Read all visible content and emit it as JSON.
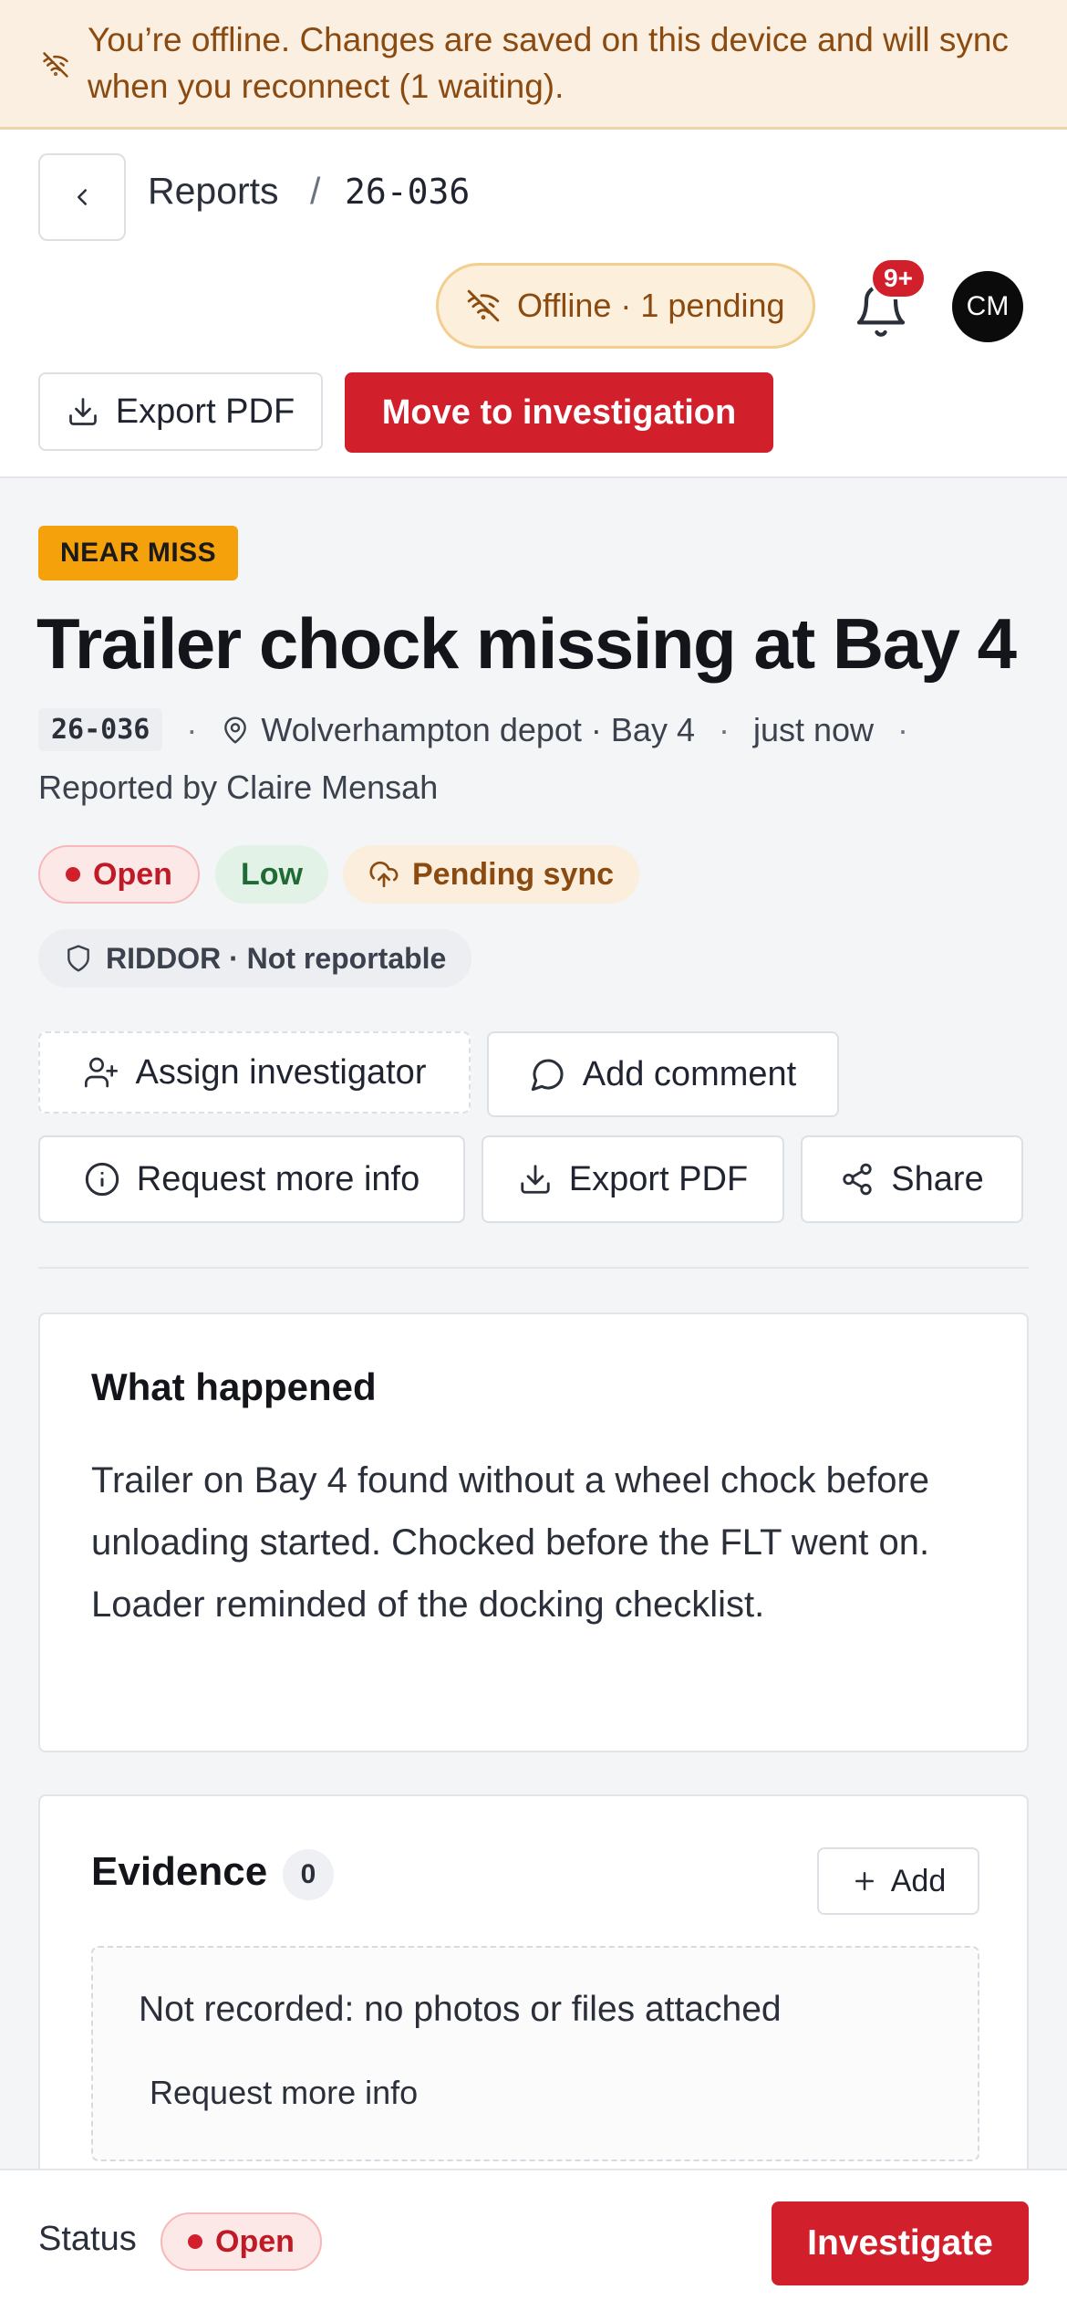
{
  "offline_banner": {
    "icon": "wifi-off-icon",
    "message": "You’re offline. Changes are saved on this device and will sync when you reconnect (1 waiting)."
  },
  "header": {
    "breadcrumb": {
      "parent": "Reports",
      "separator": "/",
      "current": "26-036"
    },
    "offline_pill": "Offline · 1 pending",
    "notifications_count": "9+",
    "avatar_initials": "CM",
    "export_pdf_label": "Export PDF",
    "move_label": "Move to investigation"
  },
  "report": {
    "type_tag": "NEAR MISS",
    "title": "Trailer chock missing at Bay 4",
    "id": "26-036",
    "location": "Wolverhampton depot · Bay 4",
    "time": "just now",
    "reported_by": "Reported by Claire Mensah",
    "status": "Open",
    "severity": "Low",
    "sync_state": "Pending sync",
    "riddor": "RIDDOR · Not reportable"
  },
  "actions": {
    "assign": "Assign investigator",
    "comment": "Add comment",
    "request_info": "Request more info",
    "export_pdf": "Export PDF",
    "share": "Share"
  },
  "what_happened": {
    "title": "What happened",
    "body": "Trailer on Bay 4 found without a wheel chock before unloading started. Chocked before the FLT went on. Loader reminded of the docking checklist."
  },
  "evidence": {
    "title": "Evidence",
    "count": "0",
    "add_label": "Add",
    "empty_text": "Not recorded: no photos or files attached",
    "request_link": "Request more info"
  },
  "footer": {
    "status_label": "Status",
    "status_value": "Open",
    "investigate_label": "Investigate"
  },
  "colors": {
    "primary": "#d11f2b",
    "warning_bg": "#faefe1",
    "warning_text": "#8a4a10",
    "near_miss": "#f5a10c",
    "low_green": "#1e6b34"
  }
}
